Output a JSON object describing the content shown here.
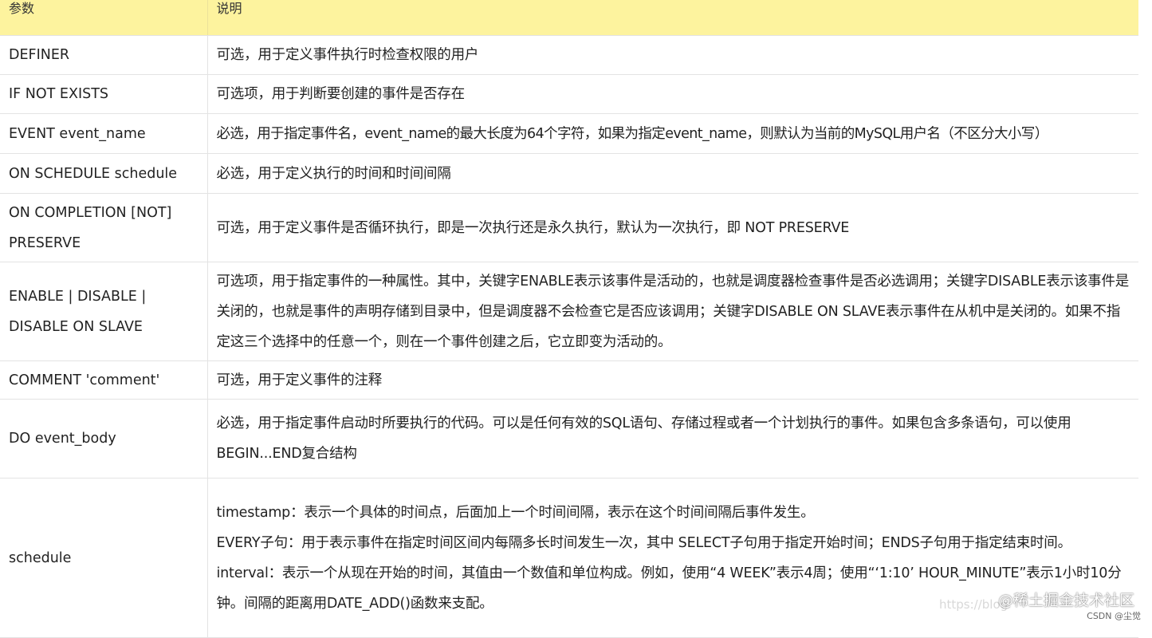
{
  "header": {
    "col_param": "参数",
    "col_desc": "说明"
  },
  "rows": [
    {
      "name": "DEFINER",
      "desc": [
        "可选，用于定义事件执行时检查权限的用户"
      ]
    },
    {
      "name": "IF NOT EXISTS",
      "desc": [
        "可选项，用于判断要创建的事件是否存在"
      ]
    },
    {
      "name": "EVENT event_name",
      "desc": [
        "必选，用于指定事件名，event_name的最大长度为64个字符，如果为指定event_name，则默认为当前的MySQL用户名（不区分大小写）"
      ]
    },
    {
      "name": "ON SCHEDULE schedule",
      "desc": [
        "必选，用于定义执行的时间和时间间隔"
      ]
    },
    {
      "name": "ON COMPLETION [NOT] PRESERVE",
      "desc": [
        "可选，用于定义事件是否循环执行，即是一次执行还是永久执行，默认为一次执行，即 NOT PRESERVE"
      ]
    },
    {
      "name": "ENABLE | DISABLE | DISABLE ON SLAVE",
      "desc": [
        "可选项，用于指定事件的一种属性。其中，关键字ENABLE表示该事件是活动的，也就是调度器检查事件是否必选调用；关键字DISABLE表示该事件是关闭的，也就是事件的声明存储到目录中，但是调度器不会检查它是否应该调用；关键字DISABLE ON SLAVE表示事件在从机中是关闭的。如果不指定这三个选择中的任意一个，则在一个事件创建之后，它立即变为活动的。"
      ]
    },
    {
      "name": "COMMENT 'comment'",
      "desc": [
        "可选，用于定义事件的注释"
      ]
    },
    {
      "name": "DO event_body",
      "desc": [
        "必选，用于指定事件启动时所要执行的代码。可以是任何有效的SQL语句、存储过程或者一个计划执行的事件。如果包含多条语句，可以使用BEGIN...END复合结构"
      ]
    },
    {
      "name": "schedule",
      "desc": [
        "timestamp：表示一个具体的时间点，后面加上一个时间间隔，表示在这个时间间隔后事件发生。",
        "EVERY子句：用于表示事件在指定时间区间内每隔多长时间发生一次，其中 SELECT子句用于指定开始时间；ENDS子句用于指定结束时间。",
        "interval：表示一个从现在开始的时间，其值由一个数值和单位构成。例如，使用“4 WEEK”表示4周；使用“‘1:10’ HOUR_MINUTE”表示1小时10分钟。间隔的距离用DATE_ADD()函数来支配。"
      ]
    }
  ],
  "watermark": {
    "blog": "https://blog",
    "brand": "@稀土掘金技术社区",
    "csdn": "CSDN @尘觉"
  }
}
